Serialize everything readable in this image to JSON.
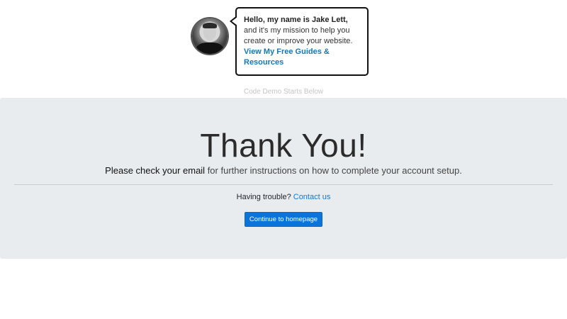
{
  "promo": {
    "intro_bold": "Hello, my name is Jake Lett,",
    "intro_rest": " and it's my mission to help you create or improve your website. ",
    "link_text": "View My Free Guides & Resources"
  },
  "demo_caption": "Code Demo Starts Below",
  "jumbotron": {
    "title": "Thank You!",
    "lead_strong": "Please check your email",
    "lead_rest": " for further instructions on how to complete your account setup.",
    "trouble_text": "Having trouble? ",
    "contact_link": "Contact us",
    "button_label": "Continue to homepage"
  },
  "colors": {
    "jumbotron_bg": "#e9ecef",
    "link": "#0b7bd8",
    "button": "#0b74da",
    "promo_link": "#1478b8"
  }
}
